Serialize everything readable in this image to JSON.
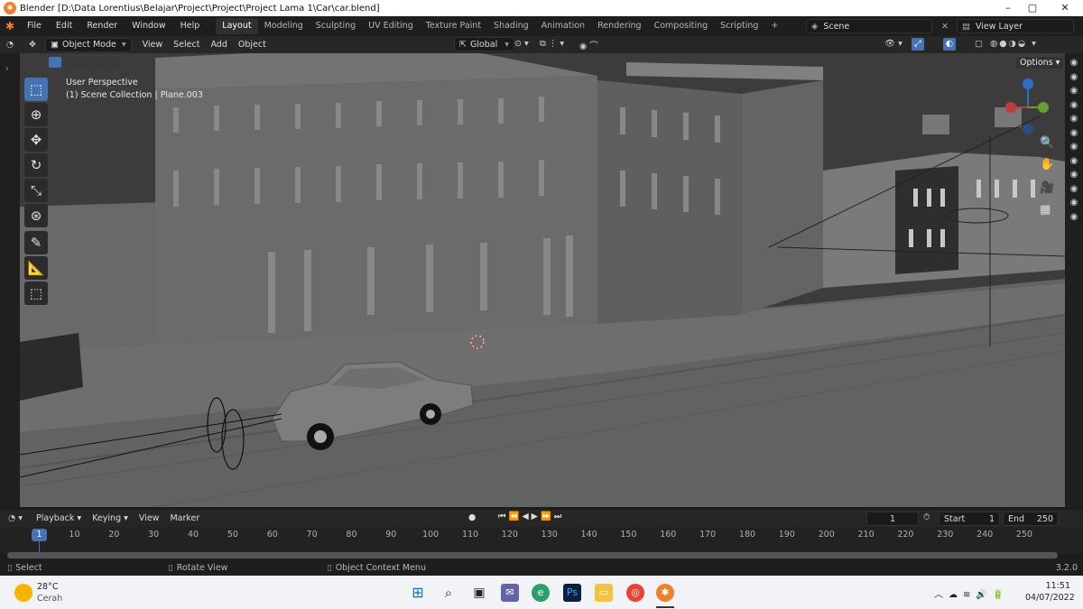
{
  "window": {
    "title": "Blender [D:\\Data Lorentius\\Belajar\\Project\\Project\\Project Lama 1\\Car\\car.blend]"
  },
  "menu": [
    "File",
    "Edit",
    "Render",
    "Window",
    "Help"
  ],
  "workspaces": [
    "Layout",
    "Modeling",
    "Sculpting",
    "UV Editing",
    "Texture Paint",
    "Shading",
    "Animation",
    "Rendering",
    "Compositing",
    "Scripting"
  ],
  "active_workspace": "Layout",
  "scene": {
    "label": "Scene",
    "view_layer": "View Layer"
  },
  "viewport_header": {
    "mode": "Object Mode",
    "view": "View",
    "select": "Select",
    "add": "Add",
    "object": "Object",
    "transform": "Global",
    "options": "Options"
  },
  "viewport": {
    "perspective": "User Perspective",
    "collection": "(1) Scene Collection | Plane.003"
  },
  "timeline": {
    "playback": "Playback",
    "keying": "Keying",
    "view": "View",
    "marker": "Marker",
    "current_frame": "1",
    "start_label": "Start",
    "start": "1",
    "end_label": "End",
    "end": "250",
    "ticks": [
      "1",
      "10",
      "20",
      "30",
      "40",
      "50",
      "60",
      "70",
      "80",
      "90",
      "100",
      "110",
      "120",
      "130",
      "140",
      "150",
      "160",
      "170",
      "180",
      "190",
      "200",
      "210",
      "220",
      "230",
      "240",
      "250"
    ]
  },
  "status": {
    "select": "Select",
    "rotate": "Rotate View",
    "context": "Object Context Menu",
    "version": "3.2.0"
  },
  "taskbar": {
    "temp": "28°C",
    "weather": "Cerah",
    "time": "11:51",
    "date": "04/07/2022"
  },
  "colors": {
    "accent": "#4772b3",
    "viewport_bg": "#3d3d3d",
    "blender_orange": "#f1802e"
  }
}
